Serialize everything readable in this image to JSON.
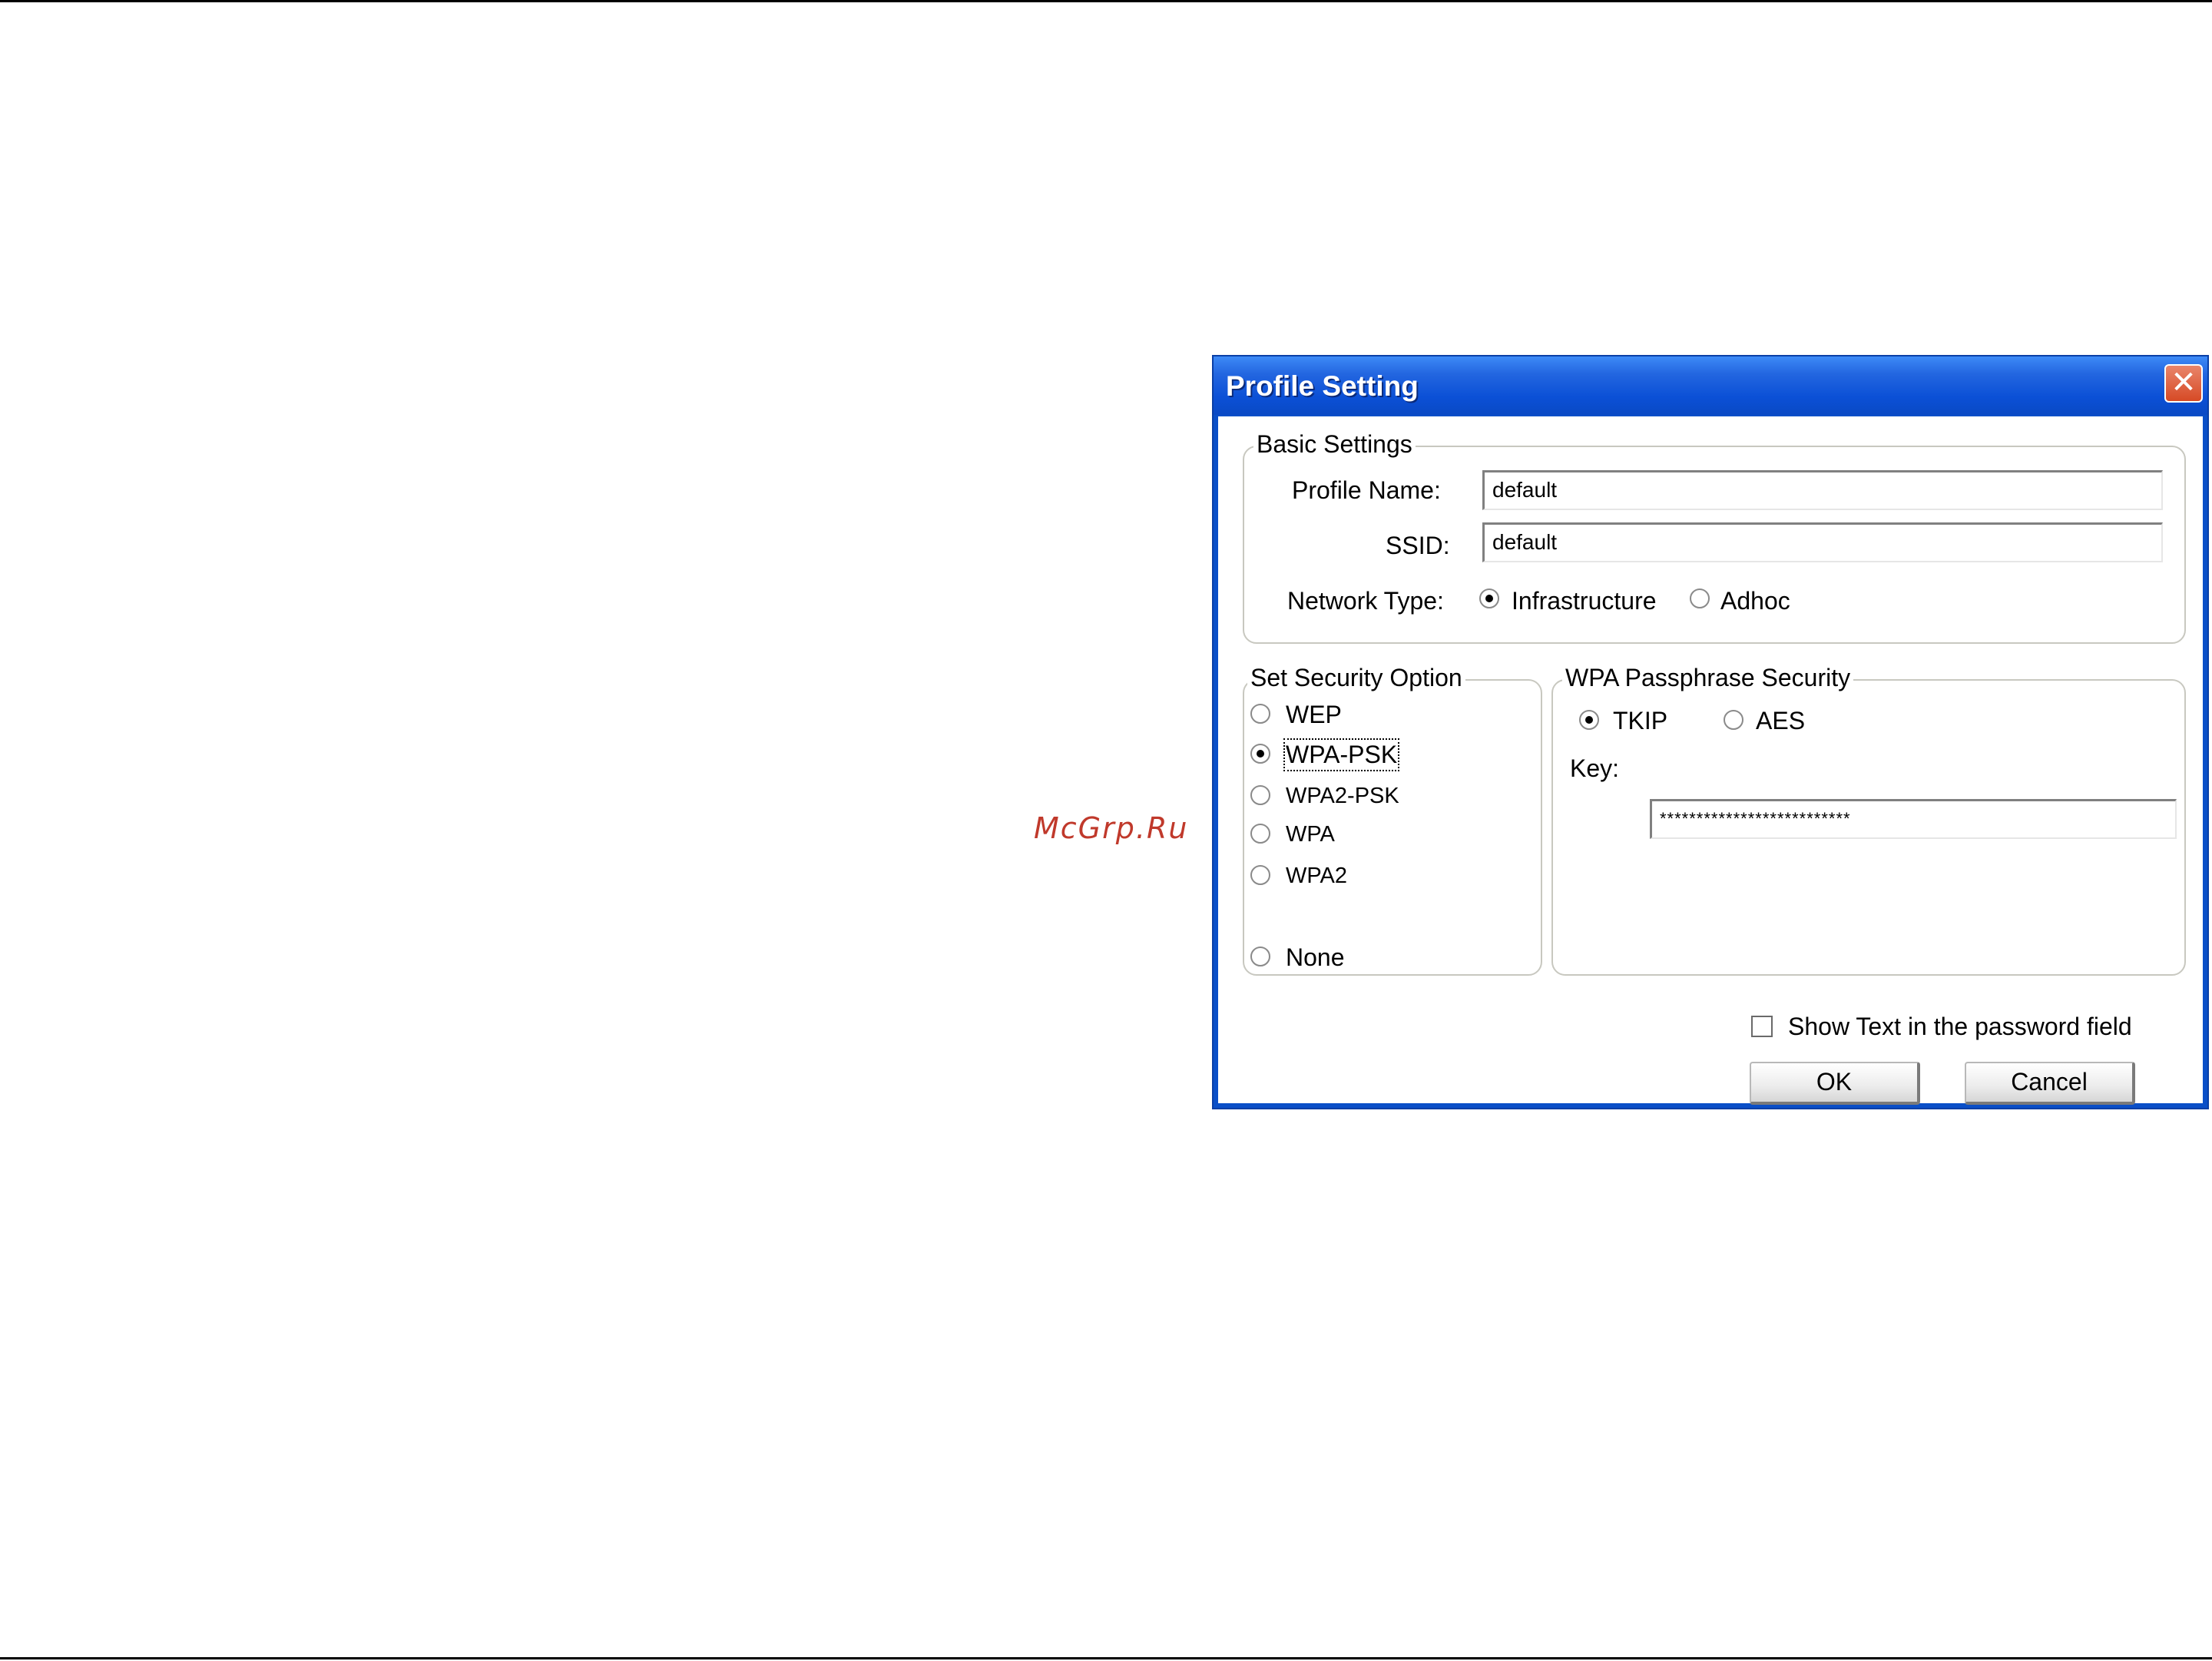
{
  "watermark": "McGrp.Ru",
  "dialog": {
    "title": "Profile Setting",
    "close_glyph": "✕",
    "basic": {
      "legend": "Basic Settings",
      "profile_name_label": "Profile Name:",
      "profile_name_value": "default",
      "ssid_label": "SSID:",
      "ssid_value": "default",
      "network_type_label": "Network Type:",
      "infrastructure": "Infrastructure",
      "adhoc": "Adhoc",
      "selected_network_type": "Infrastructure"
    },
    "security": {
      "legend": "Set Security Option",
      "options": [
        "WEP",
        "WPA-PSK",
        "WPA2-PSK",
        "WPA",
        "WPA2",
        "None"
      ],
      "selected": "WPA-PSK"
    },
    "wpa": {
      "legend": "WPA Passphrase Security",
      "tkip": "TKIP",
      "aes": "AES",
      "selected_cipher": "TKIP",
      "key_label": "Key:",
      "key_value": "**************************"
    },
    "show_text_label": "Show Text in the password field",
    "show_text_checked": false,
    "ok_label": "OK",
    "cancel_label": "Cancel"
  }
}
